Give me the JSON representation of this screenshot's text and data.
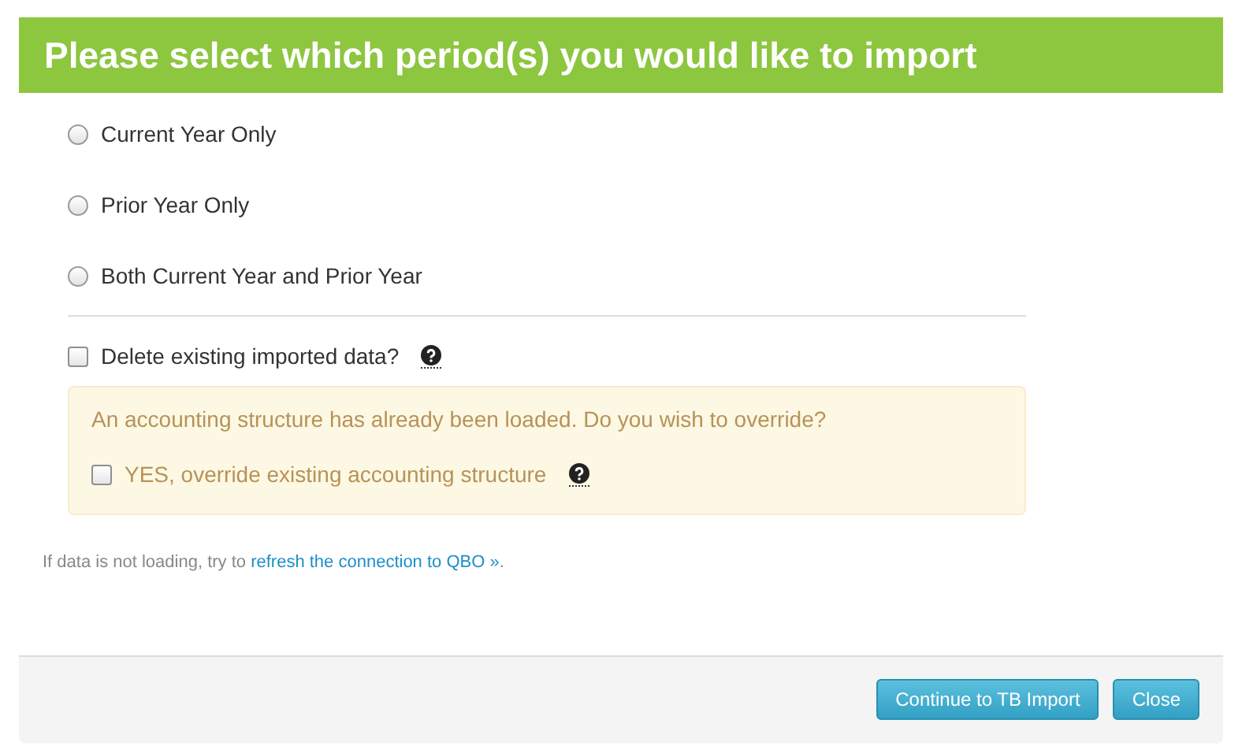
{
  "title": "Please select which period(s) you would like to import",
  "periods": [
    {
      "label": "Current Year Only",
      "selected": false
    },
    {
      "label": "Prior Year Only",
      "selected": false
    },
    {
      "label": "Both Current Year and Prior Year",
      "selected": false
    }
  ],
  "delete_option": {
    "label": "Delete existing imported data?",
    "checked": false
  },
  "warning": {
    "message": "An accounting structure has already been loaded. Do you wish to override?",
    "override": {
      "label": "YES, override existing accounting structure",
      "checked": false
    }
  },
  "hint": {
    "before": "If data is not loading, try to ",
    "link": "refresh the connection to QBO »",
    "after": "."
  },
  "buttons": [
    {
      "label": "Continue to TB Import",
      "kind": "primary"
    },
    {
      "label": "Close",
      "kind": "primary"
    }
  ]
}
